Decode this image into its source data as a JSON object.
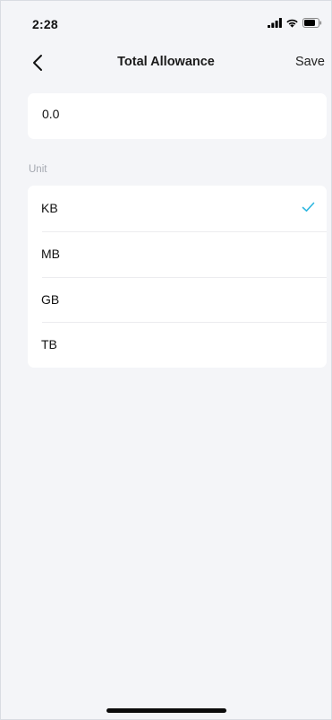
{
  "status_bar": {
    "time": "2:28",
    "icons": [
      "signal-icon",
      "wifi-icon",
      "battery-icon"
    ]
  },
  "nav": {
    "back_icon": "chevron-left-icon",
    "title": "Total Allowance",
    "save_label": "Save"
  },
  "allowance": {
    "value": "0.0"
  },
  "unit_section": {
    "label": "Unit",
    "selected": "KB",
    "options": [
      {
        "label": "KB",
        "selected": true
      },
      {
        "label": "MB",
        "selected": false
      },
      {
        "label": "GB",
        "selected": false
      },
      {
        "label": "TB",
        "selected": false
      }
    ]
  },
  "colors": {
    "background": "#f4f5f8",
    "card": "#ffffff",
    "accent_check": "#2fb7e0",
    "section_label": "#a4a8b0"
  }
}
